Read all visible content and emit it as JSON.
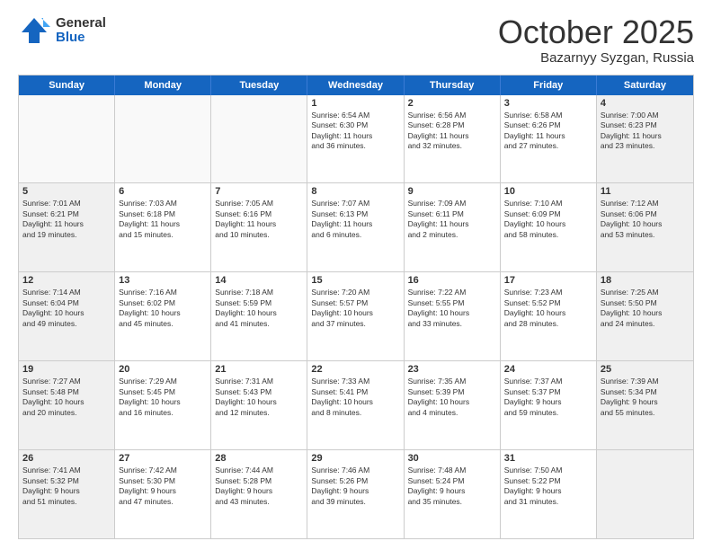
{
  "logo": {
    "general": "General",
    "blue": "Blue"
  },
  "title": "October 2025",
  "subtitle": "Bazarnyy Syzgan, Russia",
  "header_days": [
    "Sunday",
    "Monday",
    "Tuesday",
    "Wednesday",
    "Thursday",
    "Friday",
    "Saturday"
  ],
  "rows": [
    [
      {
        "day": "",
        "text": "",
        "shaded": false,
        "empty": true
      },
      {
        "day": "",
        "text": "",
        "shaded": false,
        "empty": true
      },
      {
        "day": "",
        "text": "",
        "shaded": false,
        "empty": true
      },
      {
        "day": "1",
        "text": "Sunrise: 6:54 AM\nSunset: 6:30 PM\nDaylight: 11 hours\nand 36 minutes.",
        "shaded": false,
        "empty": false
      },
      {
        "day": "2",
        "text": "Sunrise: 6:56 AM\nSunset: 6:28 PM\nDaylight: 11 hours\nand 32 minutes.",
        "shaded": false,
        "empty": false
      },
      {
        "day": "3",
        "text": "Sunrise: 6:58 AM\nSunset: 6:26 PM\nDaylight: 11 hours\nand 27 minutes.",
        "shaded": false,
        "empty": false
      },
      {
        "day": "4",
        "text": "Sunrise: 7:00 AM\nSunset: 6:23 PM\nDaylight: 11 hours\nand 23 minutes.",
        "shaded": true,
        "empty": false
      }
    ],
    [
      {
        "day": "5",
        "text": "Sunrise: 7:01 AM\nSunset: 6:21 PM\nDaylight: 11 hours\nand 19 minutes.",
        "shaded": true,
        "empty": false
      },
      {
        "day": "6",
        "text": "Sunrise: 7:03 AM\nSunset: 6:18 PM\nDaylight: 11 hours\nand 15 minutes.",
        "shaded": false,
        "empty": false
      },
      {
        "day": "7",
        "text": "Sunrise: 7:05 AM\nSunset: 6:16 PM\nDaylight: 11 hours\nand 10 minutes.",
        "shaded": false,
        "empty": false
      },
      {
        "day": "8",
        "text": "Sunrise: 7:07 AM\nSunset: 6:13 PM\nDaylight: 11 hours\nand 6 minutes.",
        "shaded": false,
        "empty": false
      },
      {
        "day": "9",
        "text": "Sunrise: 7:09 AM\nSunset: 6:11 PM\nDaylight: 11 hours\nand 2 minutes.",
        "shaded": false,
        "empty": false
      },
      {
        "day": "10",
        "text": "Sunrise: 7:10 AM\nSunset: 6:09 PM\nDaylight: 10 hours\nand 58 minutes.",
        "shaded": false,
        "empty": false
      },
      {
        "day": "11",
        "text": "Sunrise: 7:12 AM\nSunset: 6:06 PM\nDaylight: 10 hours\nand 53 minutes.",
        "shaded": true,
        "empty": false
      }
    ],
    [
      {
        "day": "12",
        "text": "Sunrise: 7:14 AM\nSunset: 6:04 PM\nDaylight: 10 hours\nand 49 minutes.",
        "shaded": true,
        "empty": false
      },
      {
        "day": "13",
        "text": "Sunrise: 7:16 AM\nSunset: 6:02 PM\nDaylight: 10 hours\nand 45 minutes.",
        "shaded": false,
        "empty": false
      },
      {
        "day": "14",
        "text": "Sunrise: 7:18 AM\nSunset: 5:59 PM\nDaylight: 10 hours\nand 41 minutes.",
        "shaded": false,
        "empty": false
      },
      {
        "day": "15",
        "text": "Sunrise: 7:20 AM\nSunset: 5:57 PM\nDaylight: 10 hours\nand 37 minutes.",
        "shaded": false,
        "empty": false
      },
      {
        "day": "16",
        "text": "Sunrise: 7:22 AM\nSunset: 5:55 PM\nDaylight: 10 hours\nand 33 minutes.",
        "shaded": false,
        "empty": false
      },
      {
        "day": "17",
        "text": "Sunrise: 7:23 AM\nSunset: 5:52 PM\nDaylight: 10 hours\nand 28 minutes.",
        "shaded": false,
        "empty": false
      },
      {
        "day": "18",
        "text": "Sunrise: 7:25 AM\nSunset: 5:50 PM\nDaylight: 10 hours\nand 24 minutes.",
        "shaded": true,
        "empty": false
      }
    ],
    [
      {
        "day": "19",
        "text": "Sunrise: 7:27 AM\nSunset: 5:48 PM\nDaylight: 10 hours\nand 20 minutes.",
        "shaded": true,
        "empty": false
      },
      {
        "day": "20",
        "text": "Sunrise: 7:29 AM\nSunset: 5:45 PM\nDaylight: 10 hours\nand 16 minutes.",
        "shaded": false,
        "empty": false
      },
      {
        "day": "21",
        "text": "Sunrise: 7:31 AM\nSunset: 5:43 PM\nDaylight: 10 hours\nand 12 minutes.",
        "shaded": false,
        "empty": false
      },
      {
        "day": "22",
        "text": "Sunrise: 7:33 AM\nSunset: 5:41 PM\nDaylight: 10 hours\nand 8 minutes.",
        "shaded": false,
        "empty": false
      },
      {
        "day": "23",
        "text": "Sunrise: 7:35 AM\nSunset: 5:39 PM\nDaylight: 10 hours\nand 4 minutes.",
        "shaded": false,
        "empty": false
      },
      {
        "day": "24",
        "text": "Sunrise: 7:37 AM\nSunset: 5:37 PM\nDaylight: 9 hours\nand 59 minutes.",
        "shaded": false,
        "empty": false
      },
      {
        "day": "25",
        "text": "Sunrise: 7:39 AM\nSunset: 5:34 PM\nDaylight: 9 hours\nand 55 minutes.",
        "shaded": true,
        "empty": false
      }
    ],
    [
      {
        "day": "26",
        "text": "Sunrise: 7:41 AM\nSunset: 5:32 PM\nDaylight: 9 hours\nand 51 minutes.",
        "shaded": true,
        "empty": false
      },
      {
        "day": "27",
        "text": "Sunrise: 7:42 AM\nSunset: 5:30 PM\nDaylight: 9 hours\nand 47 minutes.",
        "shaded": false,
        "empty": false
      },
      {
        "day": "28",
        "text": "Sunrise: 7:44 AM\nSunset: 5:28 PM\nDaylight: 9 hours\nand 43 minutes.",
        "shaded": false,
        "empty": false
      },
      {
        "day": "29",
        "text": "Sunrise: 7:46 AM\nSunset: 5:26 PM\nDaylight: 9 hours\nand 39 minutes.",
        "shaded": false,
        "empty": false
      },
      {
        "day": "30",
        "text": "Sunrise: 7:48 AM\nSunset: 5:24 PM\nDaylight: 9 hours\nand 35 minutes.",
        "shaded": false,
        "empty": false
      },
      {
        "day": "31",
        "text": "Sunrise: 7:50 AM\nSunset: 5:22 PM\nDaylight: 9 hours\nand 31 minutes.",
        "shaded": false,
        "empty": false
      },
      {
        "day": "",
        "text": "",
        "shaded": true,
        "empty": true
      }
    ]
  ]
}
